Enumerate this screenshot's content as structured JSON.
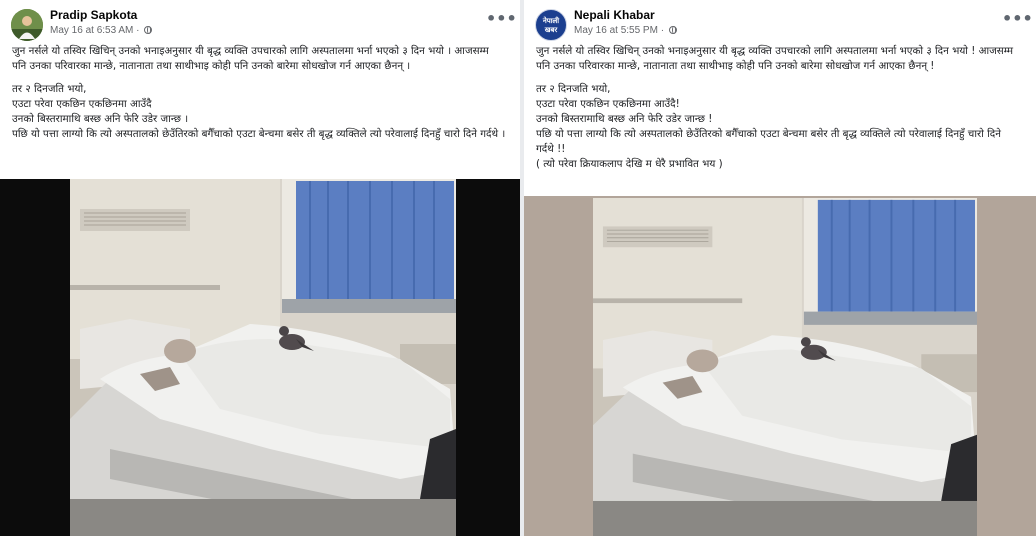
{
  "posts": [
    {
      "author": "Pradip Sapkota",
      "timestamp": "May 16 at 6:53 AM",
      "more_label": "•••",
      "paragraphs": [
        "जुन नर्सले यो तस्विर खिचिन् उनको भनाइअनुसार यी बृद्ध व्यक्ति उपचारको लागि अस्पतालमा भर्ना भएको ३ दिन भयो । आजसम्म पनि उनका परिवारका मान्छे, नातानाता तथा साथीभाइ कोही पनि उनको बारेमा सोधखोज गर्न आएका छैनन् ।",
        "तर २ दिनजति भयो,",
        "एउटा परेवा एकछिन एकछिनमा आउँदै",
        "उनको बिस्तरामाथि बस्छ अनि फेरि उडेर जान्छ ।",
        "पछि यो पत्ता लाग्यो कि त्यो अस्पतालको छेउँतिरको बगैँचाको एउटा बेन्चमा बसेर ती बृद्ध व्यक्तिले त्यो परेवालाई दिनहुँ चारो दिने गर्दथे ।"
      ]
    },
    {
      "author": "Nepali Khabar",
      "avatar_text": "नेपाली खबर",
      "timestamp": "May 16 at 5:55 PM",
      "more_label": "•••",
      "paragraphs": [
        "जुन नर्सले यो तस्विर खिचिन् उनको भनाइअनुसार यी बृद्ध व्यक्ति उपचारको लागि अस्पतालमा भर्ना भएको ३ दिन भयो ! आजसम्म पनि उनका परिवारका मान्छे, नातानाता तथा साथीभाइ कोही पनि उनको बारेमा सोधखोज गर्न आएका छैनन् !",
        "तर २ दिनजति भयो,",
        "एउटा परेवा एकछिन एकछिनमा आउँदै!",
        "उनको बिस्तरामाथि बस्छ अनि फेरि उडेर जान्छ !",
        "पछि यो पत्ता लाग्यो कि त्यो अस्पतालको छेउँतिरको बगैँचाको एउटा बेन्चमा बसेर ती बृद्ध व्यक्तिले त्यो परेवालाई दिनहुँ चारो दिने गर्दथे !!",
        "( त्यो परेवा क्रियाकलाप देखि म धेरै प्रभावित भय )"
      ]
    }
  ]
}
